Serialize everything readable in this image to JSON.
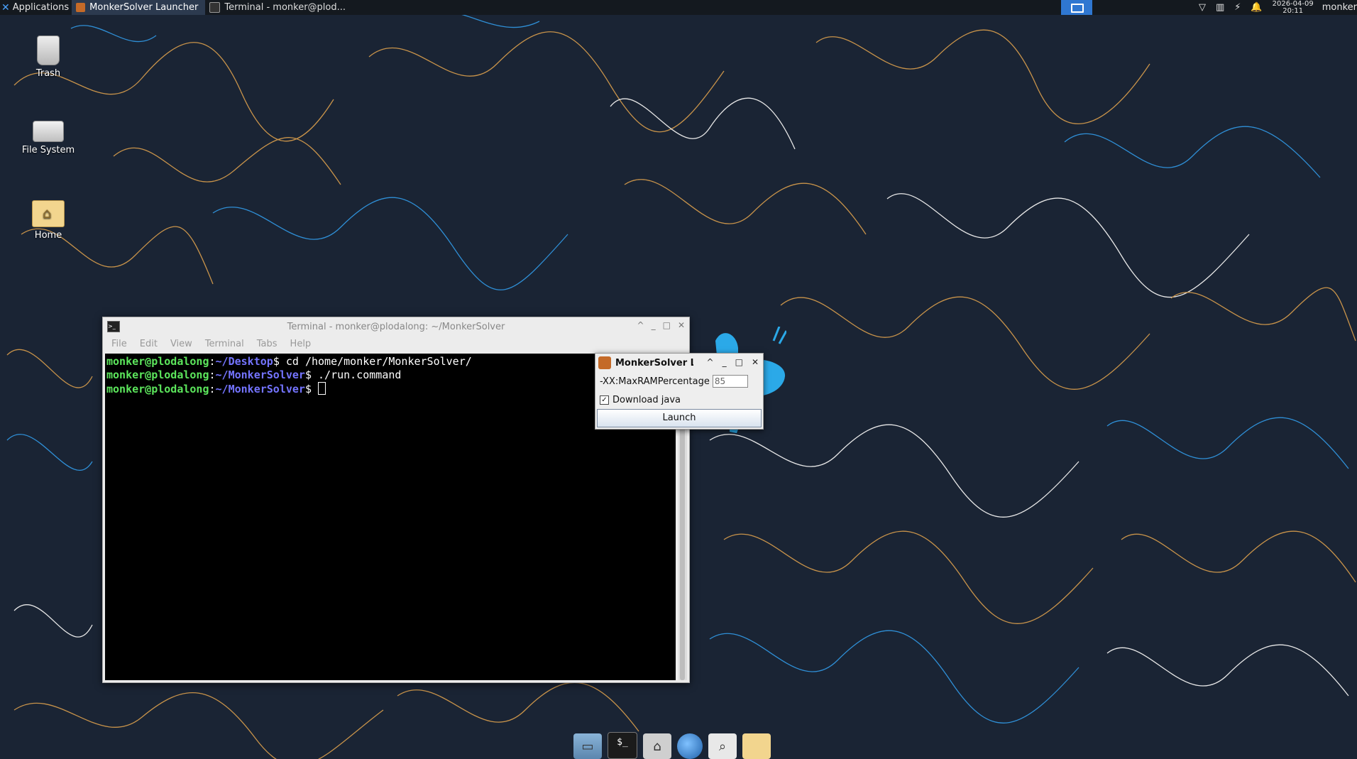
{
  "panel": {
    "applications_label": "Applications",
    "tasks": [
      {
        "label": "MonkerSolver Launcher",
        "active": true
      },
      {
        "label": "Terminal - monker@plod...",
        "active": false
      }
    ],
    "clock_date": "2026-04-09",
    "clock_time": "20:11",
    "user": "monker"
  },
  "desktop_icons": [
    {
      "label": "Trash"
    },
    {
      "label": "File System"
    },
    {
      "label": "Home"
    }
  ],
  "terminal": {
    "title": "Terminal - monker@plodalong: ~/MonkerSolver",
    "menu": [
      "File",
      "Edit",
      "View",
      "Terminal",
      "Tabs",
      "Help"
    ],
    "lines": [
      {
        "user": "monker@plodalong",
        "sep": ":",
        "path": "~/Desktop",
        "prompt": "$ ",
        "cmd": "cd /home/monker/MonkerSolver/"
      },
      {
        "user": "monker@plodalong",
        "sep": ":",
        "path": "~/MonkerSolver",
        "prompt": "$ ",
        "cmd": "./run.command"
      },
      {
        "user": "monker@plodalong",
        "sep": ":",
        "path": "~/MonkerSolver",
        "prompt": "$ ",
        "cmd": ""
      }
    ]
  },
  "launcher": {
    "title": "MonkerSolver La",
    "ram_label": "-XX:MaxRAMPercentage",
    "ram_value": "85",
    "download_label": "Download java",
    "download_checked": true,
    "launch_label": "Launch"
  },
  "colors": {
    "wallpaper_bg": "#1a2434",
    "prompt_user": "#5ce65c",
    "prompt_path": "#7474ff",
    "panel_bg": "#14191f"
  }
}
